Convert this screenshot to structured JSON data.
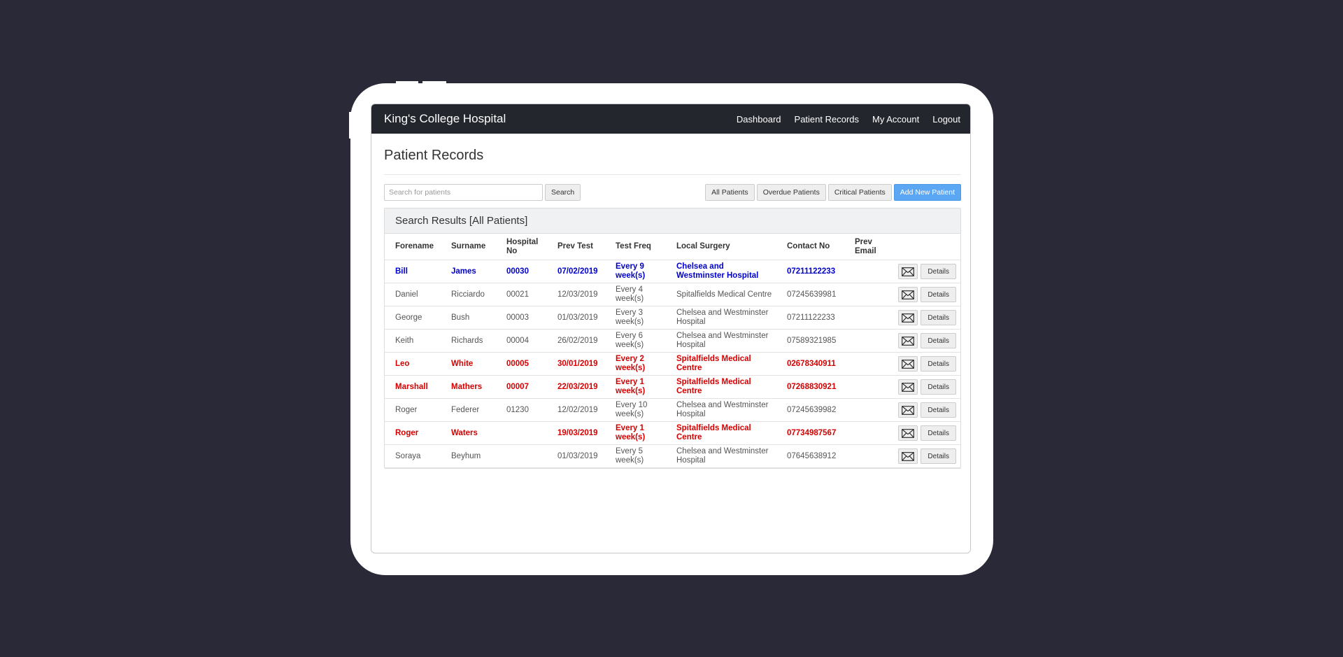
{
  "app": {
    "brand": "King's College Hospital",
    "nav": [
      "Dashboard",
      "Patient Records",
      "My Account",
      "Logout"
    ]
  },
  "page": {
    "title": "Patient Records"
  },
  "search": {
    "placeholder": "Search for patients",
    "button": "Search"
  },
  "filters": {
    "all": "All Patients",
    "overdue": "Overdue Patients",
    "critical": "Critical Patients",
    "add": "Add New Patient"
  },
  "results": {
    "heading": "Search Results [All Patients]",
    "columns": [
      "Forename",
      "Surname",
      "Hospital No",
      "Prev Test",
      "Test Freq",
      "Local Surgery",
      "Contact No",
      "Prev Email"
    ],
    "details_label": "Details",
    "rows": [
      {
        "status": "blue",
        "forename": "Bill",
        "surname": "James",
        "hospital_no": "00030",
        "prev_test": "07/02/2019",
        "test_freq": "Every 9 week(s)",
        "surgery": "Chelsea and Westminster Hospital",
        "contact": "07211122233",
        "prev_email": ""
      },
      {
        "status": "normal",
        "forename": "Daniel",
        "surname": "Ricciardo",
        "hospital_no": "00021",
        "prev_test": "12/03/2019",
        "test_freq": "Every 4 week(s)",
        "surgery": "Spitalfields Medical Centre",
        "contact": "07245639981",
        "prev_email": ""
      },
      {
        "status": "normal",
        "forename": "George",
        "surname": "Bush",
        "hospital_no": "00003",
        "prev_test": "01/03/2019",
        "test_freq": "Every 3 week(s)",
        "surgery": "Chelsea and Westminster Hospital",
        "contact": "07211122233",
        "prev_email": ""
      },
      {
        "status": "normal",
        "forename": "Keith",
        "surname": "Richards",
        "hospital_no": "00004",
        "prev_test": "26/02/2019",
        "test_freq": "Every 6 week(s)",
        "surgery": "Chelsea and Westminster Hospital",
        "contact": "07589321985",
        "prev_email": ""
      },
      {
        "status": "red",
        "forename": "Leo",
        "surname": "White",
        "hospital_no": "00005",
        "prev_test": "30/01/2019",
        "test_freq": "Every 2 week(s)",
        "surgery": "Spitalfields Medical Centre",
        "contact": "02678340911",
        "prev_email": ""
      },
      {
        "status": "red",
        "forename": "Marshall",
        "surname": "Mathers",
        "hospital_no": "00007",
        "prev_test": "22/03/2019",
        "test_freq": "Every 1 week(s)",
        "surgery": "Spitalfields Medical Centre",
        "contact": "07268830921",
        "prev_email": ""
      },
      {
        "status": "normal",
        "forename": "Roger",
        "surname": "Federer",
        "hospital_no": "01230",
        "prev_test": "12/02/2019",
        "test_freq": "Every 10 week(s)",
        "surgery": "Chelsea and Westminster Hospital",
        "contact": "07245639982",
        "prev_email": ""
      },
      {
        "status": "red",
        "forename": "Roger",
        "surname": "Waters",
        "hospital_no": "",
        "prev_test": "19/03/2019",
        "test_freq": "Every 1 week(s)",
        "surgery": "Spitalfields Medical Centre",
        "contact": "07734987567",
        "prev_email": ""
      },
      {
        "status": "normal",
        "forename": "Soraya",
        "surname": "Beyhum",
        "hospital_no": "",
        "prev_test": "01/03/2019",
        "test_freq": "Every 5 week(s)",
        "surgery": "Chelsea and Westminster Hospital",
        "contact": "07645638912",
        "prev_email": ""
      }
    ]
  },
  "colors": {
    "background": "#2a2937",
    "navbar": "#23272d",
    "primary_button": "#5ba7f3",
    "highlight_blue": "#0000cc",
    "highlight_red": "#d60000"
  },
  "icons": {
    "email": "envelope-icon"
  }
}
